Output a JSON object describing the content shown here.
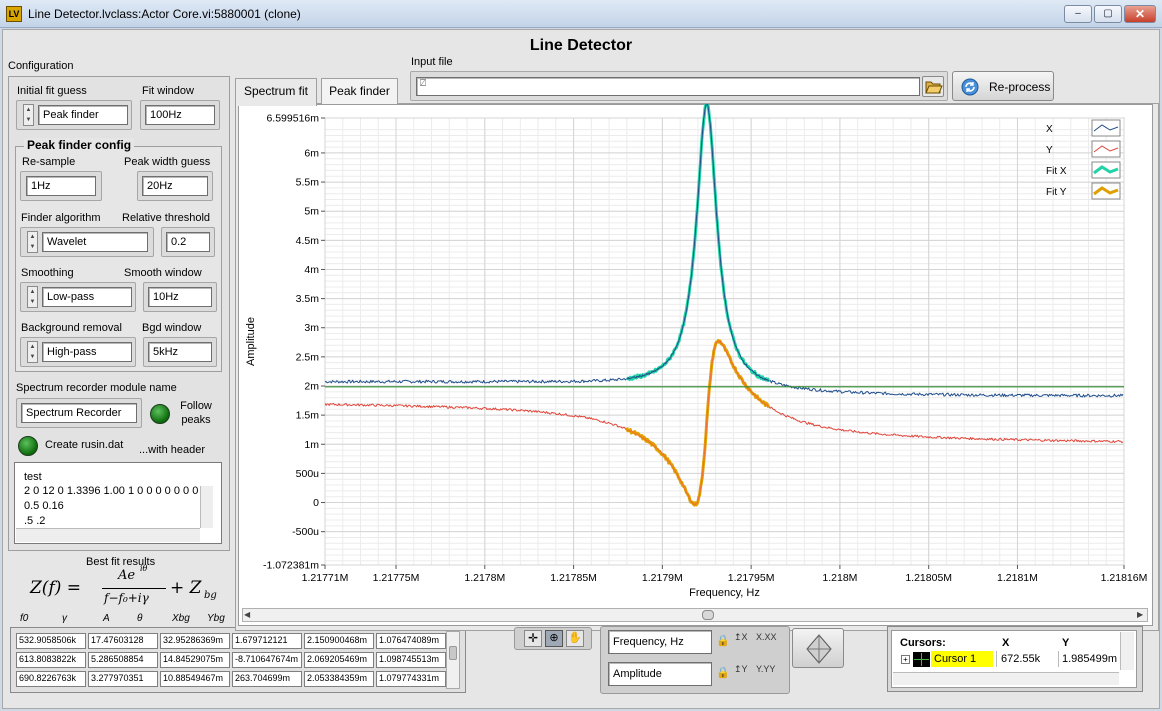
{
  "window": {
    "title": "Line Detector.lvclass:Actor Core.vi:5880001 (clone)",
    "icon_text": "LV",
    "minimize": "–",
    "maximize": "▢",
    "close": "✕"
  },
  "app": {
    "heading": "Line Detector"
  },
  "config": {
    "title": "Configuration",
    "initial_fit_guess": {
      "label": "Initial fit guess",
      "value": "Peak finder"
    },
    "fit_window": {
      "label": "Fit window",
      "value": "100Hz"
    },
    "peak_finder": {
      "title": "Peak finder config",
      "resample": {
        "label": "Re-sample",
        "value": "1Hz"
      },
      "peak_width": {
        "label": "Peak width guess",
        "value": "20Hz"
      },
      "finder_algorithm": {
        "label": "Finder algorithm",
        "value": "Wavelet"
      },
      "relative_threshold": {
        "label": "Relative threshold",
        "value": "0.2"
      },
      "smoothing": {
        "label": "Smoothing",
        "value": "Low-pass"
      },
      "smooth_window": {
        "label": "Smooth window",
        "value": "10Hz"
      },
      "background_removal": {
        "label": "Background removal",
        "value": "High-pass"
      },
      "bgd_window": {
        "label": "Bgd window",
        "value": "5kHz"
      }
    },
    "module": {
      "label": "Spectrum recorder module name",
      "value": "Spectrum Recorder",
      "follow_peaks": "Follow peaks"
    },
    "create_rusin": "Create rusin.dat",
    "with_header": "...with header",
    "notes_lines": [
      "test",
      "2 0 12 0 1.3396 1.00 1 0 0 0 0 0 0 0",
      "0.5 0.16",
      ".5 .2"
    ]
  },
  "best_fit": {
    "title": "Best fit results",
    "formula": {
      "lhs": "Z(f) =",
      "num": "Ae",
      "exp": "iθ",
      "den": "f−f₀+iγ",
      "tail": "+ Z",
      "tail_sub": "bg"
    },
    "headers": [
      "f0",
      "γ",
      "A",
      "θ",
      "Xbg",
      "Ybg"
    ],
    "rows": [
      [
        "532.9058506k",
        "17.47603128",
        "32.95286369m",
        "1.679712121",
        "2.150900468m",
        "1.076474089m"
      ],
      [
        "613.8083822k",
        "5.286508854",
        "14.84529075m",
        "-8.710647674m",
        "2.069205469m",
        "1.098745513m"
      ],
      [
        "690.8226763k",
        "3.277970351",
        "10.88549467m",
        "263.704699m",
        "2.053384359m",
        "1.079774331m"
      ]
    ]
  },
  "input": {
    "label": "Input file",
    "value": "",
    "path_glyph": "⍁",
    "browse_icon": "folder-icon",
    "reprocess": "Re-process"
  },
  "tabs": [
    {
      "label": "Spectrum fit"
    },
    {
      "label": "Peak finder"
    }
  ],
  "chart_data": {
    "type": "line",
    "title": "",
    "xlabel": "Frequency, Hz",
    "ylabel": "Amplitude",
    "xlim": [
      1217710,
      1218160
    ],
    "ylim": [
      -0.001072381,
      0.006599516
    ],
    "x_ticks": [
      {
        "v": 1217710,
        "t": "1.21771M"
      },
      {
        "v": 1217750,
        "t": "1.21775M"
      },
      {
        "v": 1217800,
        "t": "1.2178M"
      },
      {
        "v": 1217850,
        "t": "1.21785M"
      },
      {
        "v": 1217900,
        "t": "1.2179M"
      },
      {
        "v": 1217950,
        "t": "1.21795M"
      },
      {
        "v": 1218000,
        "t": "1.218M"
      },
      {
        "v": 1218050,
        "t": "1.21805M"
      },
      {
        "v": 1218100,
        "t": "1.2181M"
      },
      {
        "v": 1218160,
        "t": "1.21816M"
      }
    ],
    "y_ticks": [
      {
        "v": 0.006599516,
        "t": "6.599516m"
      },
      {
        "v": 0.006,
        "t": "6m"
      },
      {
        "v": 0.0055,
        "t": "5.5m"
      },
      {
        "v": 0.005,
        "t": "5m"
      },
      {
        "v": 0.0045,
        "t": "4.5m"
      },
      {
        "v": 0.004,
        "t": "4m"
      },
      {
        "v": 0.0035,
        "t": "3.5m"
      },
      {
        "v": 0.003,
        "t": "3m"
      },
      {
        "v": 0.0025,
        "t": "2.5m"
      },
      {
        "v": 0.002,
        "t": "2m"
      },
      {
        "v": 0.0015,
        "t": "1.5m"
      },
      {
        "v": 0.001,
        "t": "1m"
      },
      {
        "v": 0.0005,
        "t": "500u"
      },
      {
        "v": 0,
        "t": "0"
      },
      {
        "v": -0.0005,
        "t": "-500u"
      },
      {
        "v": -0.001072381,
        "t": "-1.072381m"
      }
    ],
    "grid": true,
    "legend_position": "top-right",
    "resonance": {
      "f0": 1217925,
      "gamma": 7,
      "amplitude": 0.0049,
      "background_x": 0.00195,
      "background_y_far": 0.00137
    },
    "series": [
      {
        "name": "X",
        "color": "#1f4e8c"
      },
      {
        "name": "Y",
        "color": "#e0453a"
      },
      {
        "name": "Fit X",
        "color": "#21d3a6",
        "range": [
          1217880,
          1217960
        ]
      },
      {
        "name": "Fit Y",
        "color": "#e0a000",
        "range": [
          1217880,
          1217960
        ]
      }
    ],
    "cursor": {
      "x": 1217710,
      "y": 0.001985499,
      "color": "#2e8b2e"
    }
  },
  "graph_tools": {
    "x_scale_label": "Frequency, Hz",
    "y_scale_label": "Amplitude",
    "x_format": "X.XX",
    "y_format": "Y.YY"
  },
  "cursors": {
    "title": "Cursors:",
    "col_x": "X",
    "col_y": "Y",
    "name": "Cursor 1",
    "x": "672.55k",
    "y": "1.985499m"
  }
}
